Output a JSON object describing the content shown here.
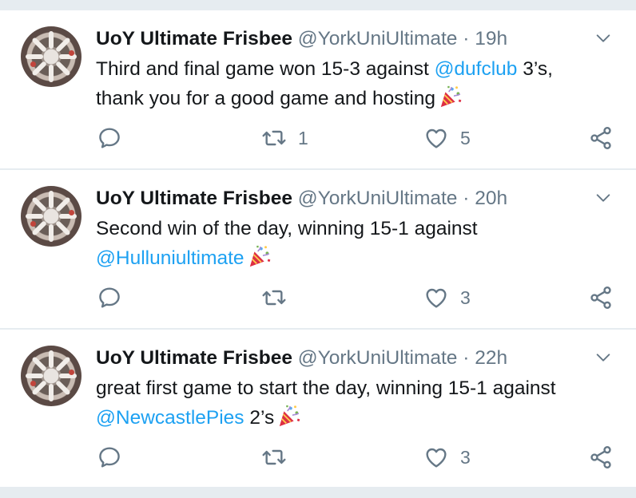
{
  "colors": {
    "link": "#1da1f2",
    "muted": "#657786",
    "text": "#14171a",
    "divider": "#e6ecf0"
  },
  "tweets": [
    {
      "name": "UoY Ultimate Frisbee",
      "handle": "@YorkUniUltimate",
      "separator": "·",
      "time": "19h",
      "text_before": "Third and final game won 15-3 against ",
      "mention": "@dufclub",
      "text_after": " 3’s,",
      "line2": "thank you for a good game and hosting",
      "emoji": "party-popper-icon",
      "retweets": "1",
      "likes": "5"
    },
    {
      "name": "UoY Ultimate Frisbee",
      "handle": "@YorkUniUltimate",
      "separator": "·",
      "time": "20h",
      "line1": "Second win of the day, winning 15-1 against",
      "mention": "@Hulluniultimate",
      "emoji": "party-popper-icon",
      "retweets": "",
      "likes": "3"
    },
    {
      "name": "UoY Ultimate Frisbee",
      "handle": "@YorkUniUltimate",
      "separator": "·",
      "time": "22h",
      "line1": "great first game to start the day, winning 15-1 against",
      "mention": "@NewcastlePies",
      "text_after": " 2’s",
      "emoji": "party-popper-icon",
      "retweets": "",
      "likes": "3"
    }
  ]
}
